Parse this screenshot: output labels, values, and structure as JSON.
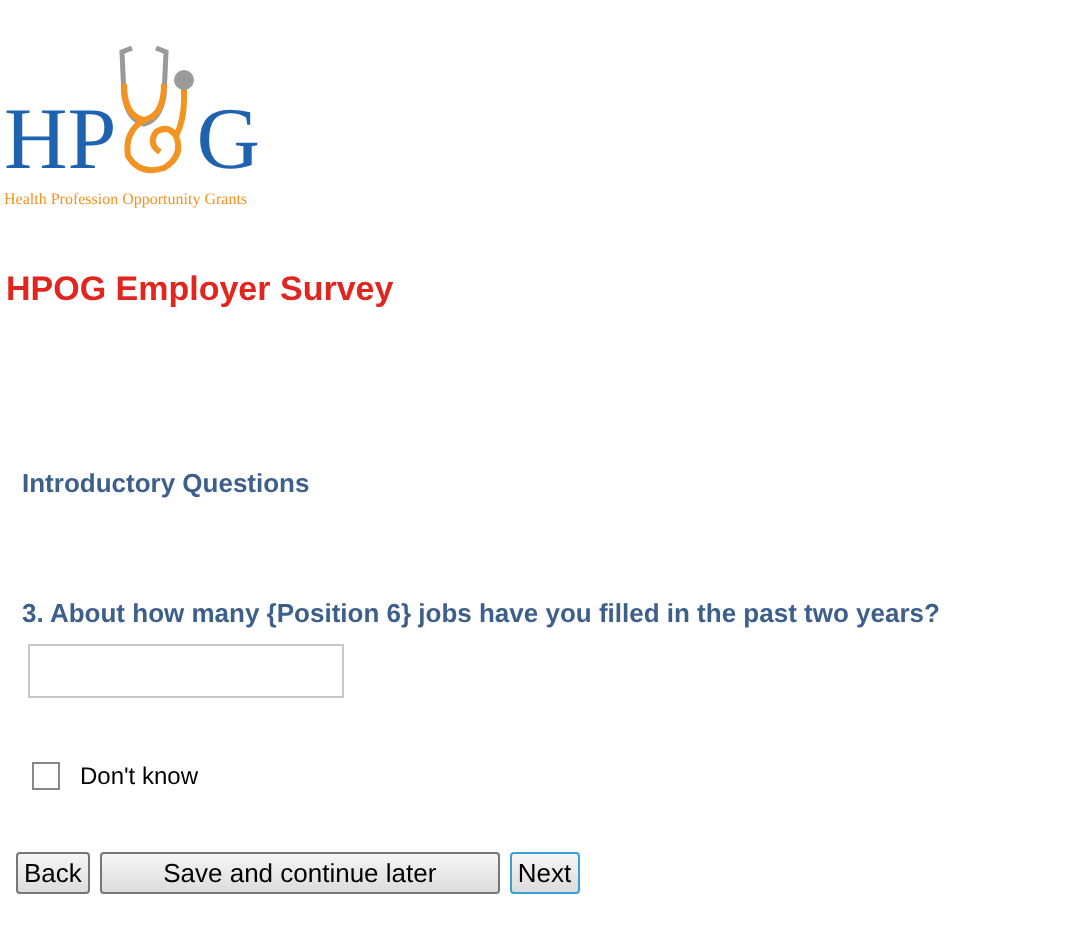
{
  "logo": {
    "letters_left": "HP",
    "letters_right": "G",
    "tagline": "Health Profession Opportunity Grants"
  },
  "title": "HPOG Employer Survey",
  "section": "Introductory Questions",
  "question": {
    "text": "3. About how many {Position 6} jobs have you filled in the past two years?"
  },
  "dont_know": {
    "label": "Don't know",
    "checked": false
  },
  "buttons": [
    {
      "label": "Back",
      "kind": "plain"
    },
    {
      "label": "Save and continue later",
      "kind": "wide"
    },
    {
      "label": "Next",
      "kind": "focused"
    }
  ]
}
